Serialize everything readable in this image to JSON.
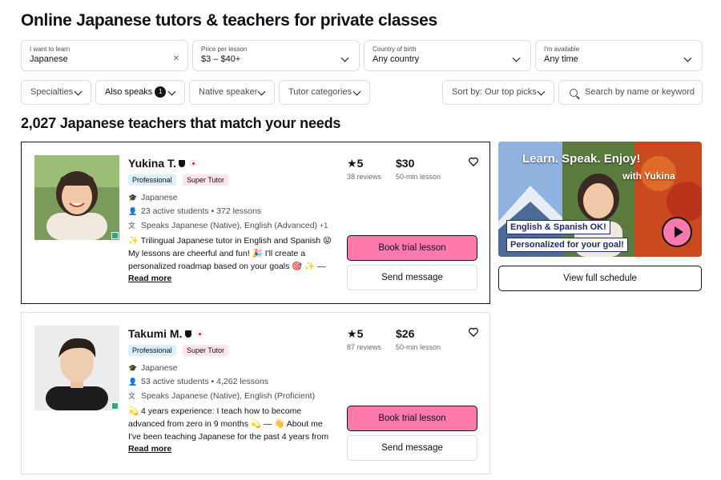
{
  "page": {
    "title": "Online Japanese tutors & teachers for private classes",
    "results_heading": "2,027 Japanese teachers that match your needs"
  },
  "filters": {
    "learn": {
      "label": "I want to learn",
      "value": "Japanese"
    },
    "price": {
      "label": "Price per lesson",
      "value": "$3 – $40+"
    },
    "country": {
      "label": "Country of birth",
      "value": "Any country"
    },
    "availability": {
      "label": "I'm available",
      "value": "Any time"
    },
    "specialties": "Specialties",
    "also_speaks": {
      "label": "Also speaks",
      "count": "1"
    },
    "native_speaker": "Native speaker",
    "tutor_categories": "Tutor categories",
    "sort": "Sort by: Our top picks",
    "search_placeholder": "Search by name or keyword"
  },
  "tutors": [
    {
      "name": "Yukina T.",
      "tags": [
        "Professional",
        "Super Tutor"
      ],
      "subject": "Japanese",
      "stats": "23 active students • 372 lessons",
      "speaks": "Speaks Japanese (Native), English (Advanced)",
      "speaks_more": "+1",
      "desc_line1": "✨ Trilingual Japanese tutor in English and Spanish 😝",
      "desc_line2": "My lessons are cheerful and fun! 🎉 I'll create a",
      "desc_line3": "personalized roadmap based on your goals 🎯 ✨ —",
      "read_more": "Read more",
      "rating": "5",
      "reviews": "38 reviews",
      "price": "$30",
      "duration": "50-min lesson",
      "book_label": "Book trial lesson",
      "message_label": "Send message"
    },
    {
      "name": "Takumi M.",
      "tags": [
        "Professional",
        "Super Tutor"
      ],
      "subject": "Japanese",
      "stats": "53 active students • 4,262 lessons",
      "speaks": "Speaks Japanese (Native), English (Proficient)",
      "desc_line1": "💫 4 years experience: I teach how to become",
      "desc_line2": "advanced from zero in 9 months 💫 — 👋 About me",
      "desc_line3": "I've been teaching Japanese for the past 4 years from",
      "read_more": "Read more",
      "rating": "5",
      "reviews": "87 reviews",
      "price": "$26",
      "duration": "50-min lesson",
      "book_label": "Book trial lesson",
      "message_label": "Send message"
    }
  ],
  "video": {
    "headline": "Learn. Speak. Enjoy!",
    "with": "with Yukina",
    "banner1": "English & Spanish OK!",
    "banner2": "Personalized for your goal!"
  },
  "schedule_button": "View full schedule",
  "colors": {
    "accent_pink": "#ff7aac",
    "online_green": "#2fa883",
    "pro_tag": "#dbeffc",
    "super_tag": "#ffe4ea"
  }
}
